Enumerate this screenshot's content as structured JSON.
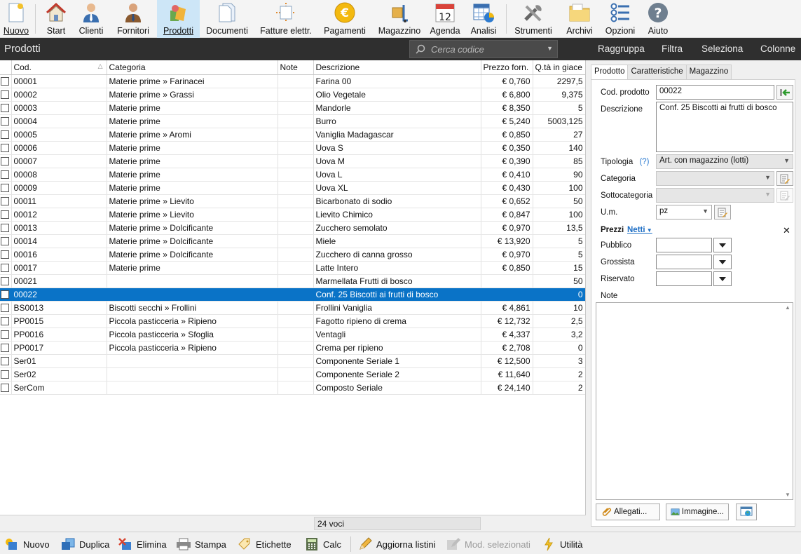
{
  "toolbar": {
    "items": [
      {
        "label": "Nuovo",
        "icon": "new-document-icon"
      },
      {
        "label": "Start",
        "icon": "home-icon"
      },
      {
        "label": "Clienti",
        "icon": "customer-icon"
      },
      {
        "label": "Fornitori",
        "icon": "supplier-icon"
      },
      {
        "label": "Prodotti",
        "icon": "products-icon",
        "active": true
      },
      {
        "label": "Documenti",
        "icon": "documents-icon"
      },
      {
        "label": "Fatture elettr.",
        "icon": "e-invoice-icon"
      },
      {
        "label": "Pagamenti",
        "icon": "euro-coin-icon"
      },
      {
        "label": "Magazzino",
        "icon": "warehouse-icon"
      },
      {
        "label": "Agenda",
        "icon": "calendar-icon",
        "calendar_day": "12"
      },
      {
        "label": "Analisi",
        "icon": "analysis-icon"
      },
      {
        "label": "Strumenti",
        "icon": "tools-icon"
      },
      {
        "label": "Archivi",
        "icon": "archive-folder-icon"
      },
      {
        "label": "Opzioni",
        "icon": "options-icon"
      },
      {
        "label": "Aiuto",
        "icon": "help-icon"
      }
    ]
  },
  "titlebar": {
    "title": "Prodotti",
    "search_placeholder": "Cerca codice",
    "links": [
      "Raggruppa",
      "Filtra",
      "Seleziona",
      "Colonne"
    ]
  },
  "grid": {
    "columns": [
      "Cod.",
      "Categoria",
      "Note",
      "Descrizione",
      "Prezzo forn.",
      "Q.tà in giace"
    ],
    "rows": [
      {
        "cod": "00001",
        "categoria": "Materie prime  »  Farinacei",
        "note": "",
        "descrizione": "Farina 00",
        "prezzo": "€ 0,760",
        "qta": "2297,5"
      },
      {
        "cod": "00002",
        "categoria": "Materie prime  »  Grassi",
        "note": "",
        "descrizione": "Olio Vegetale",
        "prezzo": "€ 6,800",
        "qta": "9,375"
      },
      {
        "cod": "00003",
        "categoria": "Materie prime",
        "note": "",
        "descrizione": "Mandorle",
        "prezzo": "€ 8,350",
        "qta": "5"
      },
      {
        "cod": "00004",
        "categoria": "Materie prime",
        "note": "",
        "descrizione": "Burro",
        "prezzo": "€ 5,240",
        "qta": "5003,125"
      },
      {
        "cod": "00005",
        "categoria": "Materie prime  »  Aromi",
        "note": "",
        "descrizione": "Vaniglia Madagascar",
        "prezzo": "€ 0,850",
        "qta": "27"
      },
      {
        "cod": "00006",
        "categoria": "Materie prime",
        "note": "",
        "descrizione": "Uova S",
        "prezzo": "€ 0,350",
        "qta": "140"
      },
      {
        "cod": "00007",
        "categoria": "Materie prime",
        "note": "",
        "descrizione": "Uova M",
        "prezzo": "€ 0,390",
        "qta": "85"
      },
      {
        "cod": "00008",
        "categoria": "Materie prime",
        "note": "",
        "descrizione": "Uova L",
        "prezzo": "€ 0,410",
        "qta": "90"
      },
      {
        "cod": "00009",
        "categoria": "Materie prime",
        "note": "",
        "descrizione": "Uova XL",
        "prezzo": "€ 0,430",
        "qta": "100"
      },
      {
        "cod": "00011",
        "categoria": "Materie prime  »  Lievito",
        "note": "",
        "descrizione": "Bicarbonato di sodio",
        "prezzo": "€ 0,652",
        "qta": "50"
      },
      {
        "cod": "00012",
        "categoria": "Materie prime  »  Lievito",
        "note": "",
        "descrizione": "Lievito Chimico",
        "prezzo": "€ 0,847",
        "qta": "100"
      },
      {
        "cod": "00013",
        "categoria": "Materie prime  »  Dolcificante",
        "note": "",
        "descrizione": "Zucchero semolato",
        "prezzo": "€ 0,970",
        "qta": "13,5"
      },
      {
        "cod": "00014",
        "categoria": "Materie prime  »  Dolcificante",
        "note": "",
        "descrizione": "Miele",
        "prezzo": "€ 13,920",
        "qta": "5"
      },
      {
        "cod": "00016",
        "categoria": "Materie prime  »  Dolcificante",
        "note": "",
        "descrizione": "Zucchero di canna grosso",
        "prezzo": "€ 0,970",
        "qta": "5"
      },
      {
        "cod": "00017",
        "categoria": "Materie prime",
        "note": "",
        "descrizione": "Latte Intero",
        "prezzo": "€ 0,850",
        "qta": "15"
      },
      {
        "cod": "00021",
        "categoria": "",
        "note": "",
        "descrizione": "Marmellata Frutti di bosco",
        "prezzo": "",
        "qta": "50"
      },
      {
        "cod": "00022",
        "categoria": "",
        "note": "",
        "descrizione": "Conf. 25 Biscotti ai frutti di bosco",
        "prezzo": "",
        "qta": "0",
        "selected": true
      },
      {
        "cod": "BS0013",
        "categoria": "Biscotti secchi  »  Frollini",
        "note": "",
        "descrizione": "Frollini Vaniglia",
        "prezzo": "€ 4,861",
        "qta": "10"
      },
      {
        "cod": "PP0015",
        "categoria": "Piccola pasticceria  »  Ripieno",
        "note": "",
        "descrizione": "Fagotto ripieno di crema",
        "prezzo": "€ 12,732",
        "qta": "2,5"
      },
      {
        "cod": "PP0016",
        "categoria": "Piccola pasticceria  »  Sfoglia",
        "note": "",
        "descrizione": "Ventagli",
        "prezzo": "€ 4,337",
        "qta": "3,2"
      },
      {
        "cod": "PP0017",
        "categoria": "Piccola pasticceria  »  Ripieno",
        "note": "",
        "descrizione": "Crema per ripieno",
        "prezzo": "€ 2,708",
        "qta": "0"
      },
      {
        "cod": "Ser01",
        "categoria": "",
        "note": "",
        "descrizione": "Componente Seriale 1",
        "prezzo": "€ 12,500",
        "qta": "3"
      },
      {
        "cod": "Ser02",
        "categoria": "",
        "note": "",
        "descrizione": "Componente Seriale 2",
        "prezzo": "€ 11,640",
        "qta": "2"
      },
      {
        "cod": "SerCom",
        "categoria": "",
        "note": "",
        "descrizione": "Composto Seriale",
        "prezzo": "€ 24,140",
        "qta": "2"
      }
    ],
    "count_label": "24 voci"
  },
  "panel": {
    "tabs": [
      "Prodotto",
      "Caratteristiche",
      "Magazzino"
    ],
    "cod_label": "Cod. prodotto",
    "cod_value": "00022",
    "descr_label": "Descrizione",
    "descr_value": "Conf. 25 Biscotti ai frutti di bosco",
    "tipologia_label": "Tipologia",
    "tipologia_help": "(?)",
    "tipologia_value": "Art. con magazzino (lotti)",
    "categoria_label": "Categoria",
    "sottocategoria_label": "Sottocategoria",
    "um_label": "U.m.",
    "um_value": "pz",
    "prezzi_label": "Prezzi",
    "prezzi_mode": "Netti",
    "close_glyph": "✕",
    "pubblico_label": "Pubblico",
    "grossista_label": "Grossista",
    "riservato_label": "Riservato",
    "note_label": "Note",
    "allegati_label": "Allegati...",
    "immagine_label": "Immagine..."
  },
  "bottombar": {
    "items": [
      {
        "label": "Nuovo",
        "icon": "new-item-icon"
      },
      {
        "label": "Duplica",
        "icon": "duplicate-icon"
      },
      {
        "label": "Elimina",
        "icon": "delete-icon"
      },
      {
        "label": "Stampa",
        "icon": "printer-icon"
      },
      {
        "label": "Etichette",
        "icon": "label-tag-icon"
      },
      {
        "label": "Calc",
        "icon": "calculator-icon"
      },
      {
        "label": "Aggiorna listini",
        "icon": "pencil-icon"
      },
      {
        "label": "Mod. selezionati",
        "icon": "edit-selected-icon",
        "disabled": true
      },
      {
        "label": "Utilità",
        "icon": "lightning-icon"
      }
    ]
  }
}
